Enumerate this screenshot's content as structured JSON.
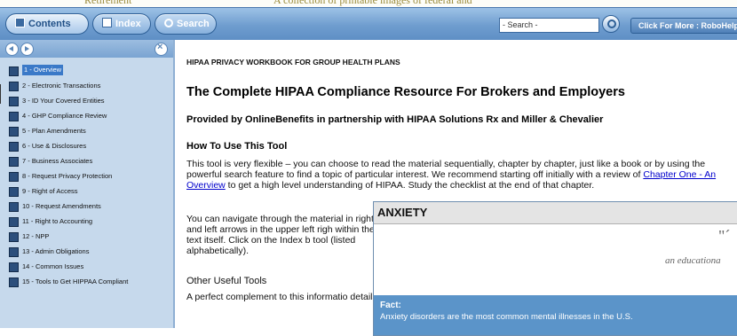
{
  "background": {
    "text_left": "Retirement",
    "text_right": "A collection of printable images of federal and"
  },
  "toolbar": {
    "tabs": [
      {
        "label": "Contents"
      },
      {
        "label": "Index"
      },
      {
        "label": "Search"
      }
    ],
    "search_value": "- Search -",
    "more_label": "Click For More : RoboHelp"
  },
  "sidebar": {
    "items": [
      {
        "label": "1 - Overview"
      },
      {
        "label": "2 - Electronic Transactions"
      },
      {
        "label": "3 - ID Your Covered Entities"
      },
      {
        "label": "4 - GHP Compliance Review"
      },
      {
        "label": "5 - Plan Amendments"
      },
      {
        "label": "6 - Use & Disclosures"
      },
      {
        "label": "7 - Business Associates"
      },
      {
        "label": "8 - Request Privacy Protection"
      },
      {
        "label": "9 - Right of Access"
      },
      {
        "label": "10 - Request Amendments"
      },
      {
        "label": "11 - Right to Accounting"
      },
      {
        "label": "12 - NPP"
      },
      {
        "label": "13 - Admin Obligations"
      },
      {
        "label": "14 - Common Issues"
      },
      {
        "label": "15 - Tools to Get HIPPAA Compliant"
      }
    ]
  },
  "main": {
    "kicker": "HIPAA PRIVACY WORKBOOK FOR GROUP HEALTH PLANS",
    "title": "The Complete HIPAA Compliance Resource For Brokers and Employers",
    "subtitle": "Provided by OnlineBenefits in partnership with HIPAA Solutions Rx and Miller & Chevalier",
    "howto_heading": "How To Use This Tool",
    "p1_before": "This tool is very flexible – you can choose to read the material sequentially, chapter by chapter, just like a book or by using the powerful search feature to find a topic of particular interest. We recommend starting off initially with a review of ",
    "p1_link": "Chapter One - An Overview",
    "p1_after": " to get a high level understanding of HIPAA. Study the checklist at the end of that chapter.",
    "p2": "You can navigate through the material in right and left arrows in the upper left righ within the text itself. Click on the Index b tool (listed alphabetically).",
    "other_heading": "Other Useful Tools",
    "p3": "A perfect complement to this informatio details."
  },
  "ad": {
    "title": "ANXIETY",
    "quote_mark": "\"´",
    "tagline": "an educationa",
    "fact_heading": "Fact:",
    "fact_body": "Anxiety disorders are the most common mental illnesses in the U.S."
  }
}
